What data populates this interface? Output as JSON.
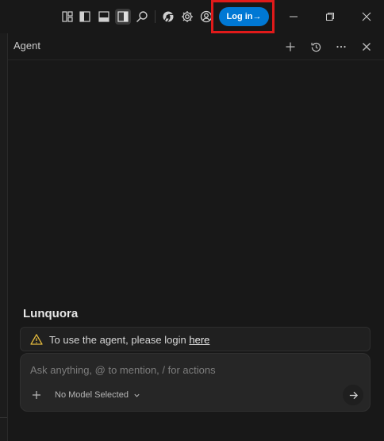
{
  "titlebar": {
    "icons": [
      "layout-customize-icon",
      "toggle-primary-sidebar-icon",
      "toggle-panel-icon",
      "toggle-secondary-sidebar-icon",
      "search-icon",
      "browser-icon",
      "settings-icon",
      "account-icon"
    ],
    "login_label": "Log in→",
    "window_controls": [
      "minimize-icon",
      "restore-icon",
      "close-icon"
    ]
  },
  "panel": {
    "title": "Agent",
    "actions": [
      "new-chat-icon",
      "history-icon",
      "more-icon",
      "close-icon"
    ]
  },
  "agent": {
    "brand": "Lunquora",
    "notice_text": "To use the agent, please login ",
    "notice_link": "here",
    "input_placeholder": "Ask anything, @ to mention, / for actions",
    "model_label": "No Model Selected"
  },
  "colors": {
    "background": "#181818",
    "accent": "#0078d4",
    "highlight": "#e01a1a",
    "warning": "#e2b93d"
  }
}
